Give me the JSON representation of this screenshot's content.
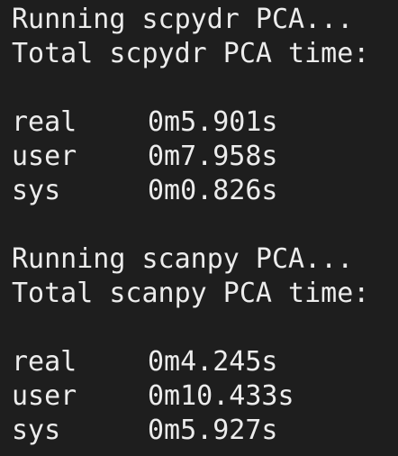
{
  "terminal": {
    "section1": {
      "running_line": "Running scpydr PCA...",
      "total_line": "Total scpydr PCA time:",
      "times": [
        {
          "label": "real",
          "value": "0m5.901s"
        },
        {
          "label": "user",
          "value": "0m7.958s"
        },
        {
          "label": "sys",
          "value": "0m0.826s"
        }
      ]
    },
    "section2": {
      "running_line": "Running scanpy PCA...",
      "total_line": "Total scanpy PCA time:",
      "times": [
        {
          "label": "real",
          "value": "0m4.245s"
        },
        {
          "label": "user",
          "value": "0m10.433s"
        },
        {
          "label": "sys",
          "value": "0m5.927s"
        }
      ]
    }
  }
}
